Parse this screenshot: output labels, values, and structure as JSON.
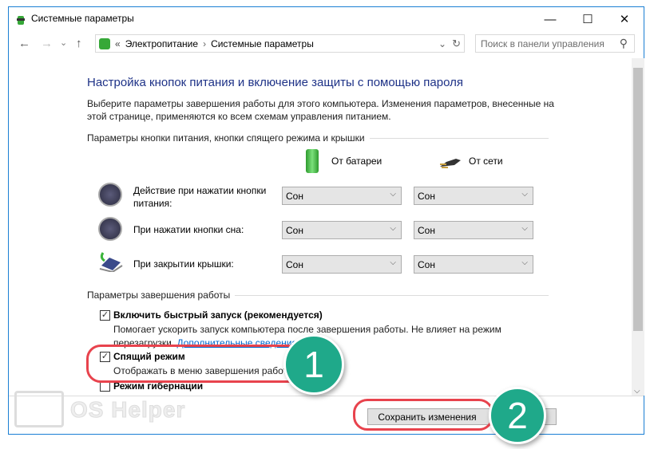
{
  "window": {
    "title": "Системные параметры",
    "minimize": "—",
    "maximize": "☐",
    "close": "✕"
  },
  "nav": {
    "back": "←",
    "forward": "→",
    "recent": "⌄",
    "up": "↑",
    "breadcrumb": [
      "«",
      "Электропитание",
      "›",
      "Системные параметры"
    ],
    "dropdown": "⌄",
    "refresh": "↻",
    "search_placeholder": "Поиск в панели управления",
    "search_icon": "⚲"
  },
  "main": {
    "heading": "Настройка кнопок питания и включение защиты с помощью пароля",
    "description": "Выберите параметры завершения работы для этого компьютера. Изменения параметров, внесенные на этой странице, применяются ко всем схемам управления питанием.",
    "group1": "Параметры кнопки питания, кнопки спящего режима и крышки",
    "col_battery": "От батареи",
    "col_ac": "От сети",
    "rows": [
      {
        "label": "Действие при нажатии кнопки питания:",
        "icon": "power-button-icon",
        "battery": "Сон",
        "ac": "Сон"
      },
      {
        "label": "При нажатии кнопки сна:",
        "icon": "sleep-button-icon",
        "battery": "Сон",
        "ac": "Сон"
      },
      {
        "label": "При закрытии крышки:",
        "icon": "laptop-lid-icon",
        "battery": "Сон",
        "ac": "Сон"
      }
    ],
    "group2": "Параметры завершения работы",
    "options": [
      {
        "label": "Включить быстрый запуск (рекомендуется)",
        "checked": true,
        "desc": "Помогает ускорить запуск компьютера после завершения работы. Не влияет на режим перезагрузки.",
        "link": "Дополнительные сведения"
      },
      {
        "label": "Спящий режим",
        "checked": true,
        "desc": "Отображать в меню завершения работы."
      },
      {
        "label": "Режим гибернации",
        "checked": false
      }
    ]
  },
  "footer": {
    "save": "Сохранить изменения"
  },
  "annotations": {
    "one": "1",
    "two": "2",
    "watermark": "OS Helper",
    "accent": "#1fa98a",
    "highlight": "#e8434d"
  }
}
